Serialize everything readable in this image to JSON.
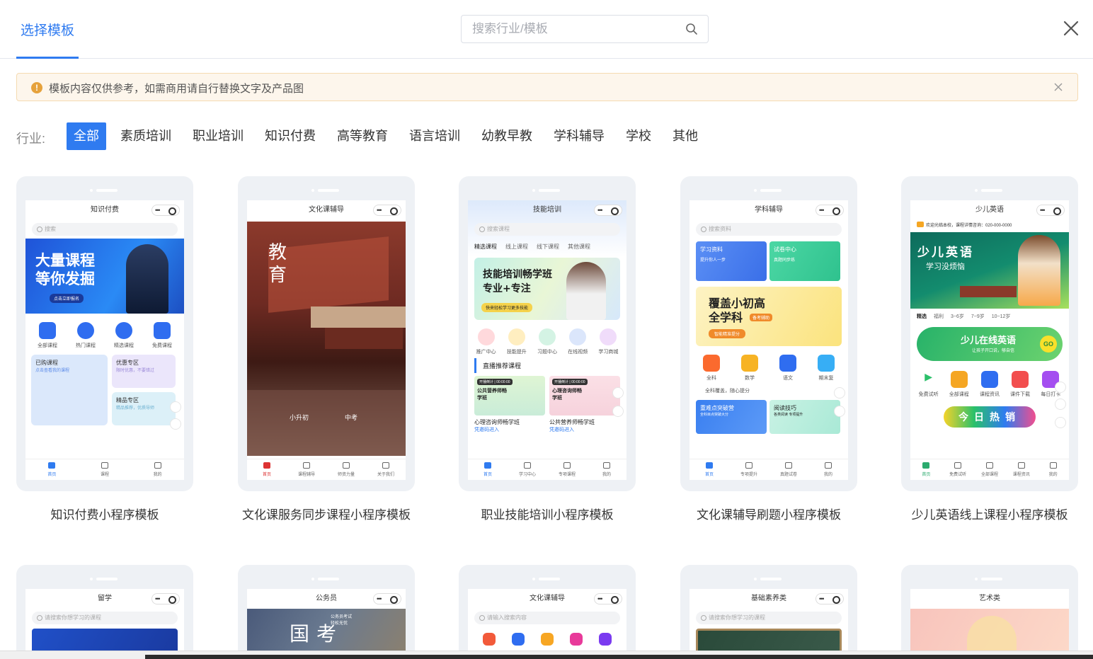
{
  "header": {
    "tab_label": "选择模板",
    "search_placeholder": "搜索行业/模板"
  },
  "notice": {
    "text": "模板内容仅供参考，如需商用请自行替换文字及产品图"
  },
  "filter": {
    "label": "行业:",
    "items": [
      "全部",
      "素质培训",
      "职业培训",
      "知识付费",
      "高等教育",
      "语言培训",
      "幼教早教",
      "学科辅导",
      "学校",
      "其他"
    ],
    "active_index": 0
  },
  "templates": [
    {
      "title": "知识付费小程序模板",
      "screen_title": "知识付费",
      "search": "搜索",
      "banner_text": "大量课程\n等你发掘",
      "banner_badge": "点击立即报名",
      "icons": [
        "全部课程",
        "热门课程",
        "精选课程",
        "免费课程"
      ],
      "tiles": [
        "已购课程",
        "优惠专区",
        "精品专区"
      ],
      "tile_subs": [
        "点击查看我的课程",
        "限时优惠，不要错过",
        "精品推荐，优质导师"
      ],
      "tabbar": [
        "首页",
        "课程",
        "我的"
      ]
    },
    {
      "title": "文化课服务同步课程小程序模板",
      "screen_title": "文化课辅导",
      "banner_text": "教\n育",
      "labels": [
        "小升初",
        "中考"
      ],
      "tabbar": [
        "首页",
        "课程辅导",
        "师资力量",
        "关于我们"
      ]
    },
    {
      "title": "职业技能培训小程序模板",
      "screen_title": "技能培训",
      "search": "搜索课程",
      "tabs": [
        "精选课程",
        "线上课程",
        "线下课程",
        "其他课程"
      ],
      "banner_text": "技能培训畅学班\n专业+专注",
      "banner_badge": "快来轻松学习更多技能",
      "icons": [
        "推广中心",
        "技能提升",
        "习题中心",
        "在线视频",
        "学习商城"
      ],
      "section": "直播推荐课程",
      "live": [
        "心理咨询师畅学班",
        "公共营养师畅学班"
      ],
      "live_sub": "凭邀码进入",
      "live_tag": "开播倒计 | 00:00:00",
      "live_banner": [
        "公共营养师畅学班",
        "心理咨询师畅学班"
      ],
      "tabbar": [
        "首页",
        "学习中心",
        "专项课程",
        "我的"
      ]
    },
    {
      "title": "文化课辅导刷题小程序模板",
      "screen_title": "学科辅导",
      "search": "搜索资料",
      "tiles": [
        "学习资料",
        "试卷中心"
      ],
      "tile_subs": [
        "提升你人一步",
        "真题同步练"
      ],
      "banner_text": "覆盖小初高\n全学科",
      "banner_badge": "智能精准提分",
      "banner_tag": "备考辅助",
      "icons": [
        "全科",
        "数学",
        "语文",
        "期末复"
      ],
      "notice": "全科覆盖，随心提分",
      "cards": [
        "重难点突破营",
        "阅读技巧"
      ],
      "card_subs": [
        "全科目点突破大分",
        "各类阅读 专项提升"
      ],
      "tabbar": [
        "首页",
        "专项提升",
        "真题试卷",
        "我的"
      ]
    },
    {
      "title": "少儿英语线上课程小程序模板",
      "screen_title": "少儿英语",
      "notice": "欢迎光临本校，课程详情咨询：020-000-0000",
      "banner_text": "少儿英语",
      "banner_sub": "学习没烦恼",
      "tabs": [
        "精选",
        "福利",
        "3~6岁",
        "7~9岁",
        "10~12岁"
      ],
      "promo": "少儿在线英语",
      "promo_sub": "让孩子开口说，够自信",
      "promo_go": "GO",
      "icons": [
        "免费试听",
        "全部课程",
        "课程资讯",
        "课件下载",
        "每日打卡"
      ],
      "hot": "今日热销",
      "tabbar": [
        "首页",
        "免费试听",
        "全部课程",
        "课程资讯",
        "我的"
      ]
    },
    {
      "screen_title": "留学",
      "search": "请搜索你想学习的课程"
    },
    {
      "screen_title": "公务员",
      "banner_text": "国考",
      "banner_sub": "公务员考试\n轻松无忧"
    },
    {
      "screen_title": "文化课辅导",
      "search": "请输入搜索内容"
    },
    {
      "screen_title": "基础素养类",
      "search": "请搜索你想学习的课程"
    },
    {
      "screen_title": "艺术类"
    }
  ],
  "colors": {
    "accent": "#2f7bf0",
    "warning": "#e6a23c",
    "notice_bg": "#fdf6ec"
  }
}
